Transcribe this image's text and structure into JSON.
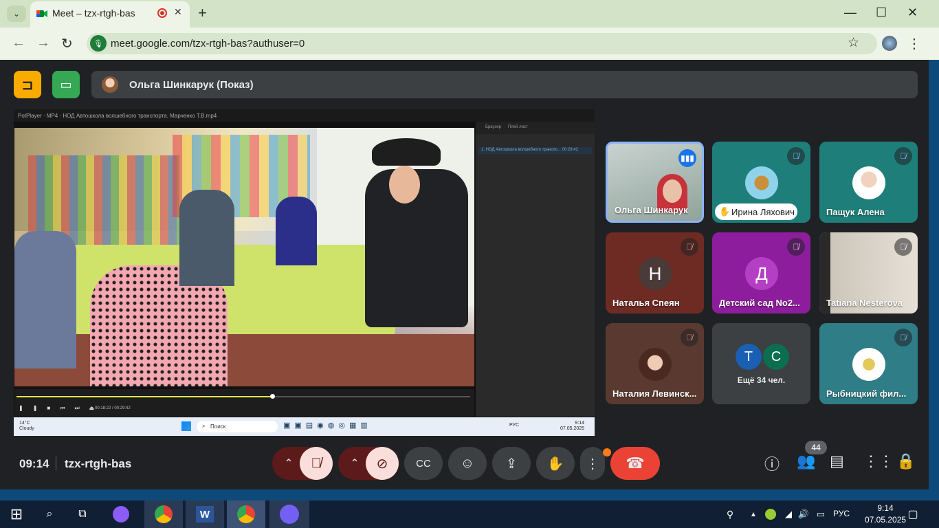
{
  "browser": {
    "tab_title": "Meet – tzx-rtgh-bas",
    "url": "meet.google.com/tzx-rtgh-bas?authuser=0"
  },
  "presenter": {
    "label": "Ольга Шинкарук (Показ)"
  },
  "shared_screen": {
    "player_title": "PotPlayer  ·  MP4  ·  НОД Автошкола волшебного транспорта. Марченко Т.В.mp4",
    "time": "00:18:22 / 00:29:42",
    "playlist_tabs": "Браузер      Плей лист",
    "playlist_item": "1. НОД Автошкола волшебного транспо...   00:29:42",
    "taskbar_weather": "14°C\nCloudy",
    "taskbar_search": "Поиск",
    "taskbar_lang": "РУС",
    "taskbar_clock": "9:14\n07.05.2025"
  },
  "participants": [
    {
      "name": "Ольга Шинкарук",
      "type": "video",
      "status": "speaking"
    },
    {
      "name": "Ирина Ляхович",
      "type": "avatar",
      "status": "muted",
      "hand": true
    },
    {
      "name": "Пащук Алена",
      "type": "avatar",
      "status": "muted"
    },
    {
      "name": "Наталья Спеян",
      "letter": "Н",
      "type": "letter",
      "status": "muted-red"
    },
    {
      "name": "Детский сад No2...",
      "letter": "Д",
      "type": "letter",
      "status": "muted"
    },
    {
      "name": "Tatiana Nesterova",
      "type": "video",
      "status": "muted"
    },
    {
      "name": "Наталия Левинск...",
      "type": "avatar",
      "status": "muted-red"
    },
    {
      "name": "Ещё 34 чел.",
      "letters": [
        "T",
        "C"
      ],
      "type": "more"
    },
    {
      "name": "Рыбницкий фил...",
      "type": "avatar",
      "status": "muted"
    }
  ],
  "meeting": {
    "clock": "09:14",
    "code": "tzx-rtgh-bas",
    "participant_count": "44"
  },
  "os": {
    "lang": "РУС",
    "time": "9:14",
    "date": "07.05.2025"
  },
  "colors": {
    "meet_bg": "#202124",
    "end_call": "#ea4335",
    "muted_btn": "#f9dedc",
    "accent_blue": "#8ab4f8"
  }
}
